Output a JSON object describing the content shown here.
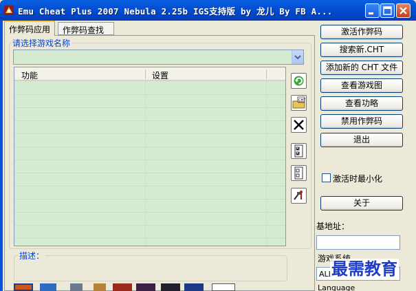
{
  "window": {
    "title": "Emu Cheat Plus 2007  Nebula 2.25b IGS支持版 by 龙儿  By FB A...",
    "icon": "app-icon"
  },
  "tabs": [
    {
      "label": "作弊码应用",
      "active": true
    },
    {
      "label": "作弊码查找",
      "active": false
    }
  ],
  "game_group": {
    "title": "请选择游戏名称",
    "selected": ""
  },
  "list": {
    "columns": [
      "功能",
      "设置"
    ],
    "rows": []
  },
  "side_tools": [
    {
      "name": "refresh-icon"
    },
    {
      "name": "cht-folder-icon"
    },
    {
      "name": "delete-icon"
    },
    {
      "name": "check-list-icon"
    },
    {
      "name": "empty-list-icon"
    },
    {
      "name": "tools-icon"
    }
  ],
  "description": {
    "title": "描述："
  },
  "buttons": {
    "activate": "激活作弊码",
    "search_new": "搜索新.CHT",
    "add_cht": "添加新的 CHT 文件",
    "view_image": "查看游戏图",
    "view_guide": "查看功略",
    "disable": "禁用作弊码",
    "exit": "退出",
    "about": "关于"
  },
  "minimize_option": {
    "label": "激活时最小化",
    "checked": false
  },
  "base_address": {
    "label": "基地址：",
    "value": ""
  },
  "game_system": {
    "label": "游戏系统",
    "value": "ALL"
  },
  "language": {
    "label": "Language"
  },
  "watermark": "最需教育",
  "colors": {
    "titlebar": "#0553D8",
    "list_bg": "#D4EBD2",
    "accent": "#0046D5"
  }
}
